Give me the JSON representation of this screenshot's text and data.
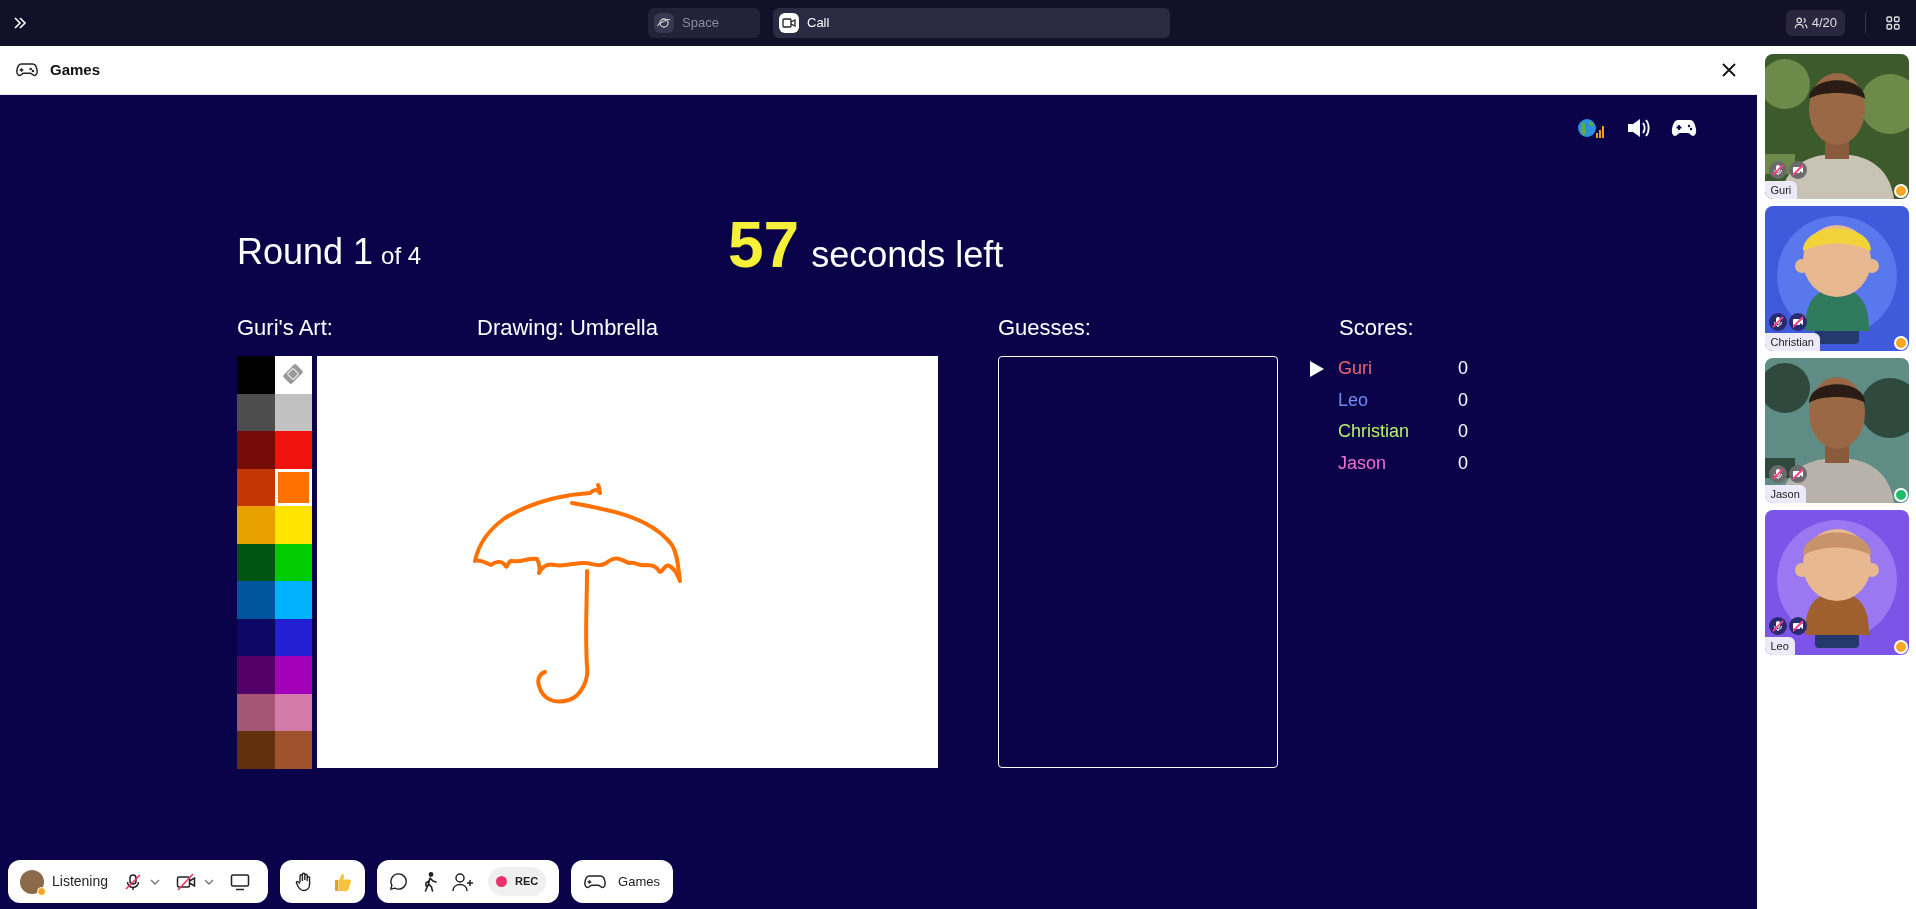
{
  "top_bar": {
    "tabs": [
      {
        "label": "Space",
        "selected": false
      },
      {
        "label": "Call",
        "selected": true
      }
    ],
    "participant_count": "4/20"
  },
  "panel": {
    "title": "Games"
  },
  "game": {
    "round": "Round 1",
    "round_of": "of 4",
    "seconds": "57",
    "seconds_label": "seconds left",
    "artist_label": "Guri's Art:",
    "drawing_label": "Drawing: Umbrella",
    "guesses_label": "Guesses:",
    "scores_label": "Scores:",
    "palette": [
      {
        "kind": "color",
        "color": "#000000",
        "selected": false
      },
      {
        "kind": "eraser",
        "selected": false
      },
      {
        "kind": "color",
        "color": "#4d4d4d",
        "selected": false
      },
      {
        "kind": "color",
        "color": "#c1c1c1",
        "selected": false
      },
      {
        "kind": "color",
        "color": "#740b07",
        "selected": false
      },
      {
        "kind": "color",
        "color": "#ef130b",
        "selected": false
      },
      {
        "kind": "color",
        "color": "#c23800",
        "selected": false
      },
      {
        "kind": "color",
        "color": "#ff7100",
        "selected": true
      },
      {
        "kind": "color",
        "color": "#e8a200",
        "selected": false
      },
      {
        "kind": "color",
        "color": "#ffe400",
        "selected": false
      },
      {
        "kind": "color",
        "color": "#005510",
        "selected": false
      },
      {
        "kind": "color",
        "color": "#00cc00",
        "selected": false
      },
      {
        "kind": "color",
        "color": "#00569e",
        "selected": false
      },
      {
        "kind": "color",
        "color": "#00b2ff",
        "selected": false
      },
      {
        "kind": "color",
        "color": "#0e0865",
        "selected": false
      },
      {
        "kind": "color",
        "color": "#231fd3",
        "selected": false
      },
      {
        "kind": "color",
        "color": "#550069",
        "selected": false
      },
      {
        "kind": "color",
        "color": "#a300ba",
        "selected": false
      },
      {
        "kind": "color",
        "color": "#a75574",
        "selected": false
      },
      {
        "kind": "color",
        "color": "#d37caa",
        "selected": false
      },
      {
        "kind": "color",
        "color": "#63300d",
        "selected": false
      },
      {
        "kind": "color",
        "color": "#a0522d",
        "selected": false
      }
    ],
    "scores": [
      {
        "name": "Guri",
        "score": "0",
        "color": "#f06570",
        "selected": true
      },
      {
        "name": "Leo",
        "score": "0",
        "color": "#6f8cf5",
        "selected": false
      },
      {
        "name": "Christian",
        "score": "0",
        "color": "#b8f26a",
        "selected": false
      },
      {
        "name": "Jason",
        "score": "0",
        "color": "#f070d0",
        "selected": false
      }
    ]
  },
  "participants": [
    {
      "name": "Guri",
      "color": "#f5a623"
    },
    {
      "name": "Christian",
      "kind": "avatar",
      "color": "#f5a623"
    },
    {
      "name": "Jason",
      "color": "#1bbf6a"
    },
    {
      "name": "Leo",
      "kind": "avatar",
      "color": "#f5a623"
    }
  ],
  "toolbar": {
    "status": "Listening",
    "record": "REC",
    "games": "Games"
  }
}
